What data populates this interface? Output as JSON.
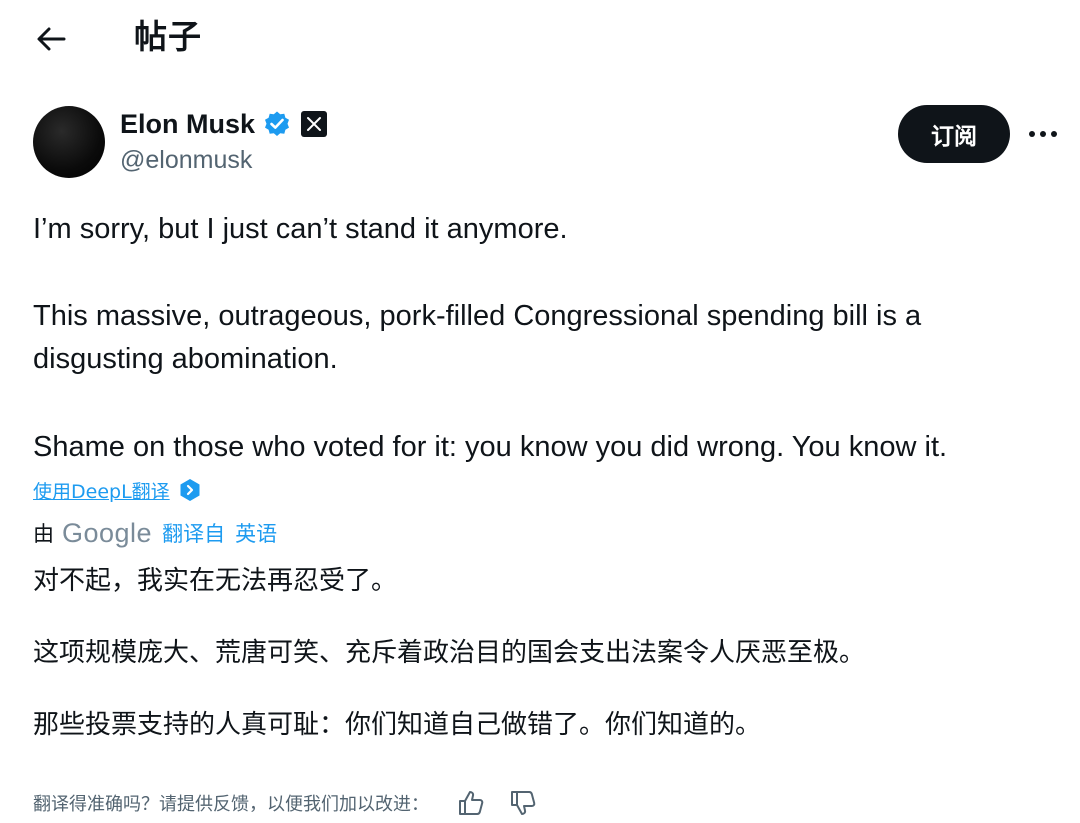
{
  "header": {
    "title": "帖子",
    "back_icon": "arrow-left-icon"
  },
  "author": {
    "name": "Elon Musk",
    "handle": "@elonmusk",
    "badges": [
      "verified-icon",
      "x-logo-icon"
    ],
    "verified_color": "#1d9bf0"
  },
  "actions": {
    "subscribe_label": "订阅",
    "more_icon": "more-horizontal-icon"
  },
  "tweet": {
    "paragraphs": [
      "I’m sorry, but I just can’t stand it anymore.",
      "This massive, outrageous, pork-filled Congressional spending bill is a",
      "disgusting abomination.",
      "Shame on those who voted for it: you know you did wrong. You know it."
    ]
  },
  "translation": {
    "deepl_link": "使用DeepL翻译",
    "by_label": "由",
    "provider": "Google",
    "translated_from_label": "翻译自",
    "source_language": "英语",
    "lines": [
      "对不起，我实在无法再忍受了。",
      "这项规模庞大、荒唐可笑、充斥着政治目的国会支出法案令人厌恶至极。",
      "那些投票支持的人真可耻：你们知道自己做错了。你们知道的。"
    ],
    "feedback_prompt": "翻译得准确吗？请提供反馈，以便我们加以改进：",
    "feedback_icons": [
      "thumbs-up-icon",
      "thumbs-down-icon"
    ]
  },
  "colors": {
    "text": "#0f1419",
    "secondary": "#536471",
    "link": "#1d9bf0",
    "button_bg": "#0f1419"
  }
}
